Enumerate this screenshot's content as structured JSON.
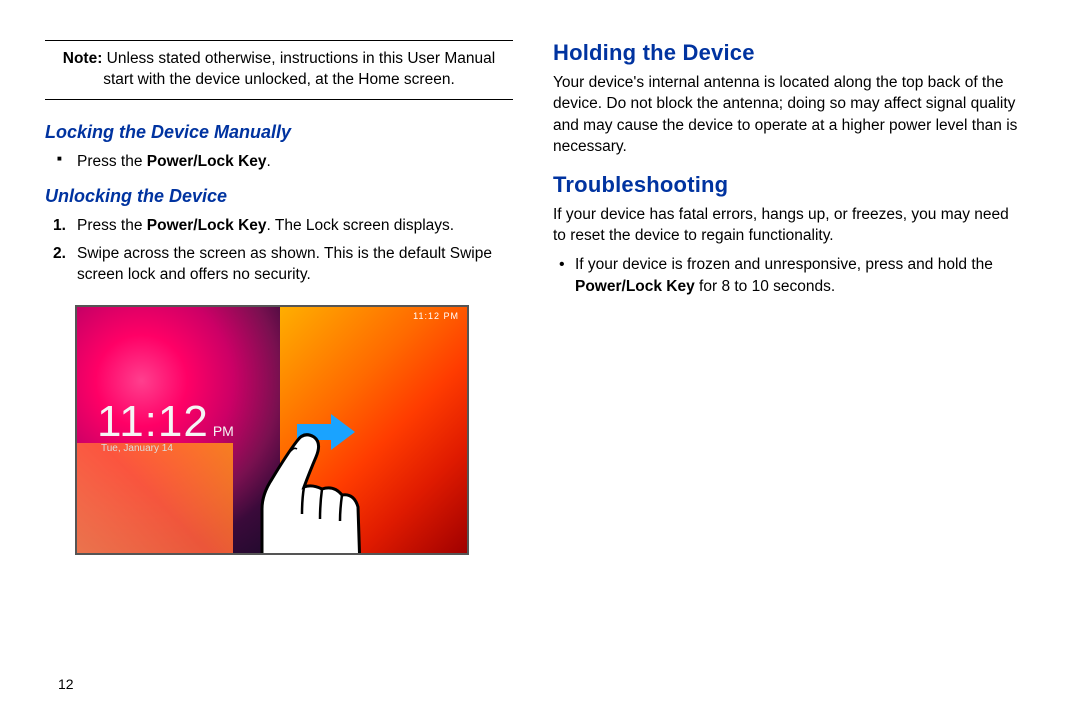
{
  "left": {
    "note_label": "Note:",
    "note_text": " Unless stated otherwise, instructions in this User Manual start with the device unlocked, at the Home screen.",
    "section_lock": "Locking the Device Manually",
    "lock_item_pre": "Press the ",
    "lock_item_key": "Power/Lock Key",
    "lock_item_post": ".",
    "section_unlock": "Unlocking the Device",
    "unlock_1_pre": "Press the ",
    "unlock_1_key": "Power/Lock Key",
    "unlock_1_post": ". The Lock screen displays.",
    "unlock_2": "Swipe across the screen as shown. This is the default Swipe screen lock and offers no security.",
    "num1": "1.",
    "num2": "2.",
    "fig_time": "11:12",
    "fig_ampm": "PM",
    "fig_date": "Tue, January 14",
    "fig_status": "11:12 PM"
  },
  "right": {
    "h_holding": "Holding the Device",
    "holding_body": "Your device's internal antenna is located along the top back of the device. Do not block the antenna; doing so may affect signal quality and may cause the device to operate at a higher power level than is necessary.",
    "h_trouble": "Troubleshooting",
    "trouble_body": "If your device has fatal errors, hangs up, or freezes, you may need to reset the device to regain functionality.",
    "trouble_item_pre": "If your device is frozen and unresponsive, press and hold the ",
    "trouble_item_key": "Power/Lock Key",
    "trouble_item_post": " for 8 to 10 seconds."
  },
  "page_number": "12"
}
